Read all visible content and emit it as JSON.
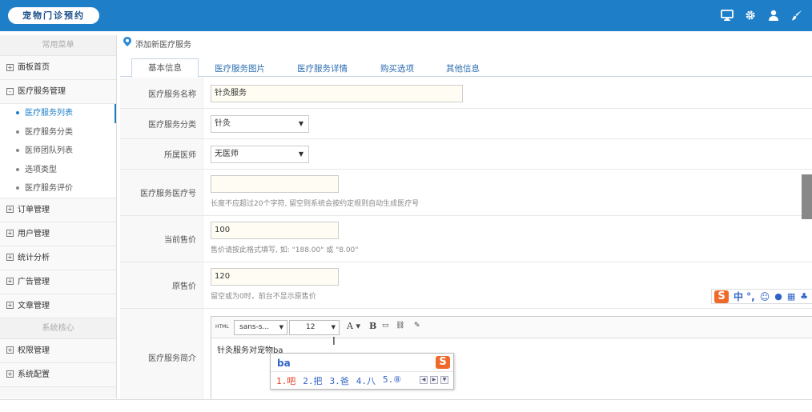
{
  "header": {
    "brand": "宠物门诊预约"
  },
  "sidebar": {
    "section_title": "常用菜单",
    "items": [
      {
        "label": "面板首页",
        "toggle": "+"
      },
      {
        "label": "医疗服务管理",
        "toggle": "-"
      }
    ],
    "sub_items": [
      "医疗服务列表",
      "医疗服务分类",
      "医师团队列表",
      "选项类型",
      "医疗服务评价"
    ],
    "items2": [
      {
        "label": "订单管理",
        "toggle": "+"
      },
      {
        "label": "用户管理",
        "toggle": "+"
      },
      {
        "label": "统计分析",
        "toggle": "+"
      },
      {
        "label": "广告管理",
        "toggle": "+"
      },
      {
        "label": "文章管理",
        "toggle": "+"
      }
    ],
    "section_title2": "系统核心",
    "items3": [
      {
        "label": "权限管理",
        "toggle": "+"
      },
      {
        "label": "系统配置",
        "toggle": "+"
      }
    ]
  },
  "main": {
    "breadcrumb": "添加新医疗服务",
    "tabs": [
      "基本信息",
      "医疗服务图片",
      "医疗服务详情",
      "购买选项",
      "其他信息"
    ],
    "form": {
      "name_label": "医疗服务名称",
      "name_value": "针灸服务",
      "category_label": "医疗服务分类",
      "category_value": "针灸",
      "doctor_label": "所属医师",
      "doctor_value": "无医师",
      "code_label": "医疗服务医疗号",
      "code_value": "",
      "code_hint": "长度不应超过20个字符, 留空则系统会按约定规则自动生成医疗号",
      "price_label": "当前售价",
      "price_value": "100",
      "price_hint": "售价请按此格式填写, 如: \"188.00\" 或 \"8.00\"",
      "orig_label": "原售价",
      "orig_value": "120",
      "orig_hint": "留空或为0时，前台不显示原售价",
      "intro_label": "医疗服务简介",
      "editor": {
        "html_btn": "HTML",
        "font_family": "sans-s...",
        "font_size": "12",
        "bold": "B",
        "content": "针灸服务对宠物ba"
      }
    }
  },
  "ime": {
    "bar_text": "中 °,",
    "composition": "ba",
    "candidates": [
      "1.吧",
      "2.把",
      "3.爸",
      "4.八",
      "5.⑧"
    ]
  }
}
